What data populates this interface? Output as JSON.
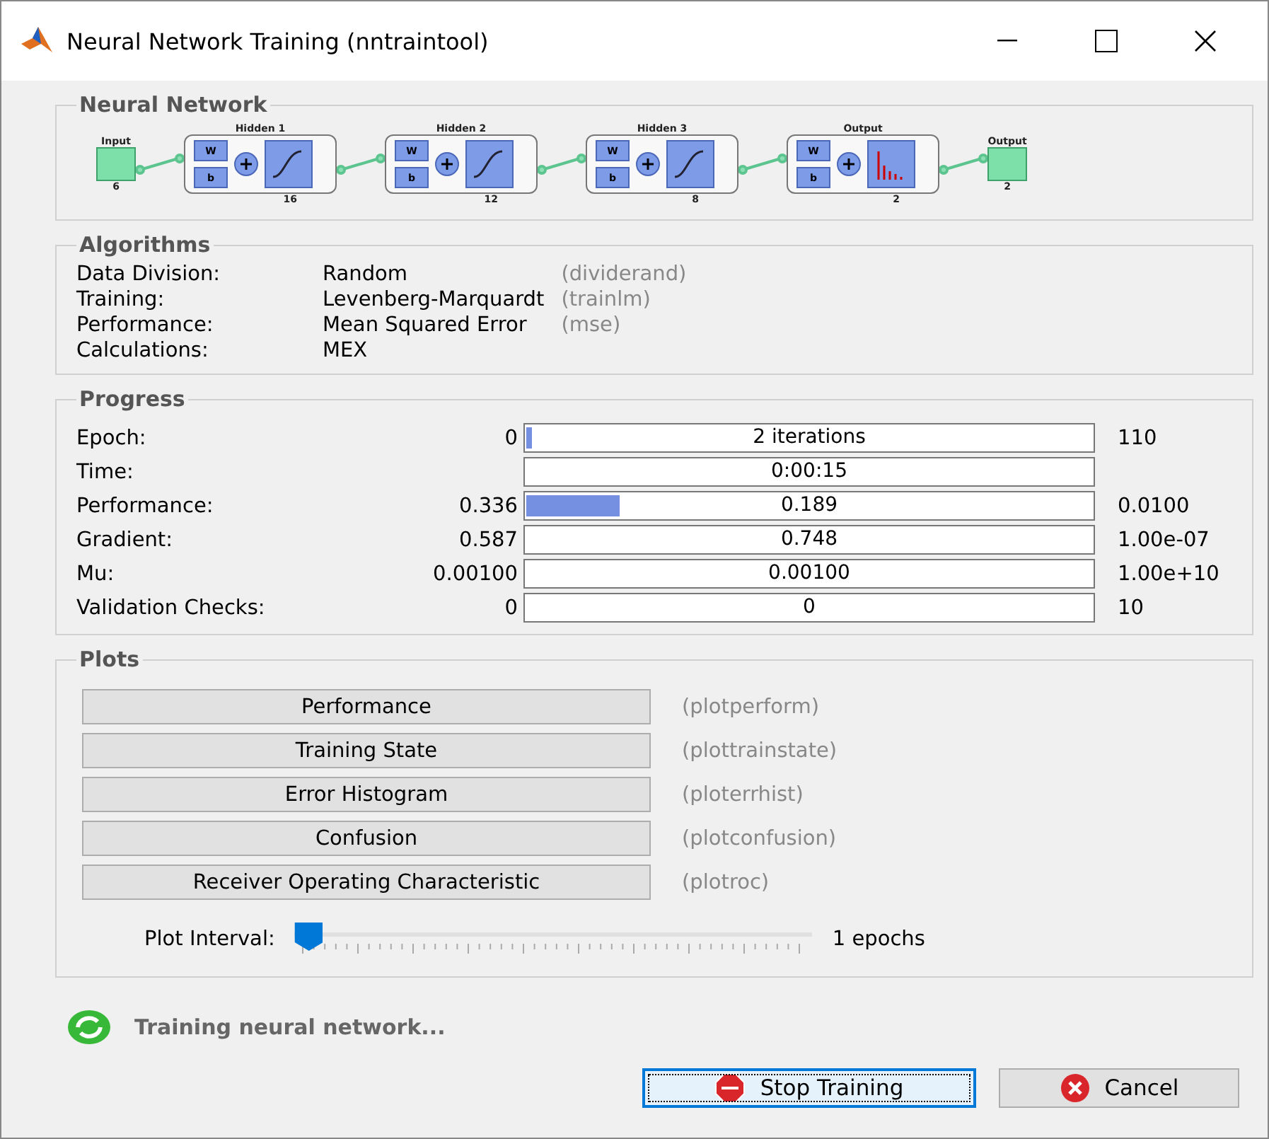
{
  "window": {
    "title": "Neural Network Training (nntraintool)"
  },
  "network": {
    "title": "Neural Network",
    "input": {
      "label": "Input",
      "size": "6"
    },
    "output": {
      "label": "Output",
      "size": "2"
    },
    "layers": [
      {
        "title": "Hidden 1",
        "size": "16",
        "weight_label": "W",
        "bias_label": "b",
        "kind": "sigmoid"
      },
      {
        "title": "Hidden 2",
        "size": "12",
        "weight_label": "W",
        "bias_label": "b",
        "kind": "sigmoid"
      },
      {
        "title": "Hidden 3",
        "size": "8",
        "weight_label": "W",
        "bias_label": "b",
        "kind": "sigmoid"
      },
      {
        "title": "Output",
        "size": "2",
        "weight_label": "W",
        "bias_label": "b",
        "kind": "softmax"
      }
    ]
  },
  "algorithms": {
    "title": "Algorithms",
    "rows": [
      {
        "label": "Data Division:",
        "value": "Random",
        "function": "(dividerand)"
      },
      {
        "label": "Training:",
        "value": "Levenberg-Marquardt",
        "function": "(trainlm)"
      },
      {
        "label": "Performance:",
        "value": "Mean Squared Error",
        "function": "(mse)"
      },
      {
        "label": "Calculations:",
        "value": "MEX"
      }
    ]
  },
  "progress": {
    "title": "Progress",
    "rows": [
      {
        "label": "Epoch:",
        "start": "0",
        "bar_text": "2 iterations",
        "level": 0.015,
        "end": "110"
      },
      {
        "label": "Time:",
        "bar_text": "0:00:15"
      },
      {
        "label": "Performance:",
        "start": "0.336",
        "bar_text": "0.189",
        "level": 0.17,
        "end": "0.0100"
      },
      {
        "label": "Gradient:",
        "start": "0.587",
        "bar_text": "0.748",
        "end": "1.00e-07"
      },
      {
        "label": "Mu:",
        "start": "0.00100",
        "bar_text": "0.00100",
        "end": "1.00e+10"
      },
      {
        "label": "Validation Checks:",
        "start": "0",
        "bar_text": "0",
        "end": "10"
      }
    ]
  },
  "plots": {
    "title": "Plots",
    "buttons": [
      {
        "label": "Performance",
        "function": "(plotperform)"
      },
      {
        "label": "Training State",
        "function": "(plottrainstate)"
      },
      {
        "label": "Error Histogram",
        "function": "(ploterrhist)"
      },
      {
        "label": "Confusion",
        "function": "(plotconfusion)"
      },
      {
        "label": "Receiver Operating Characteristic",
        "function": "(plotroc)"
      }
    ],
    "interval": {
      "label": "Plot Interval:",
      "level": 0,
      "reading": "1 epochs"
    }
  },
  "status": "Training neural network...",
  "buttons": [
    {
      "label": "Stop Training",
      "kind": "stop",
      "focused": true
    },
    {
      "label": "Cancel",
      "kind": "cancel",
      "focused": false
    }
  ]
}
